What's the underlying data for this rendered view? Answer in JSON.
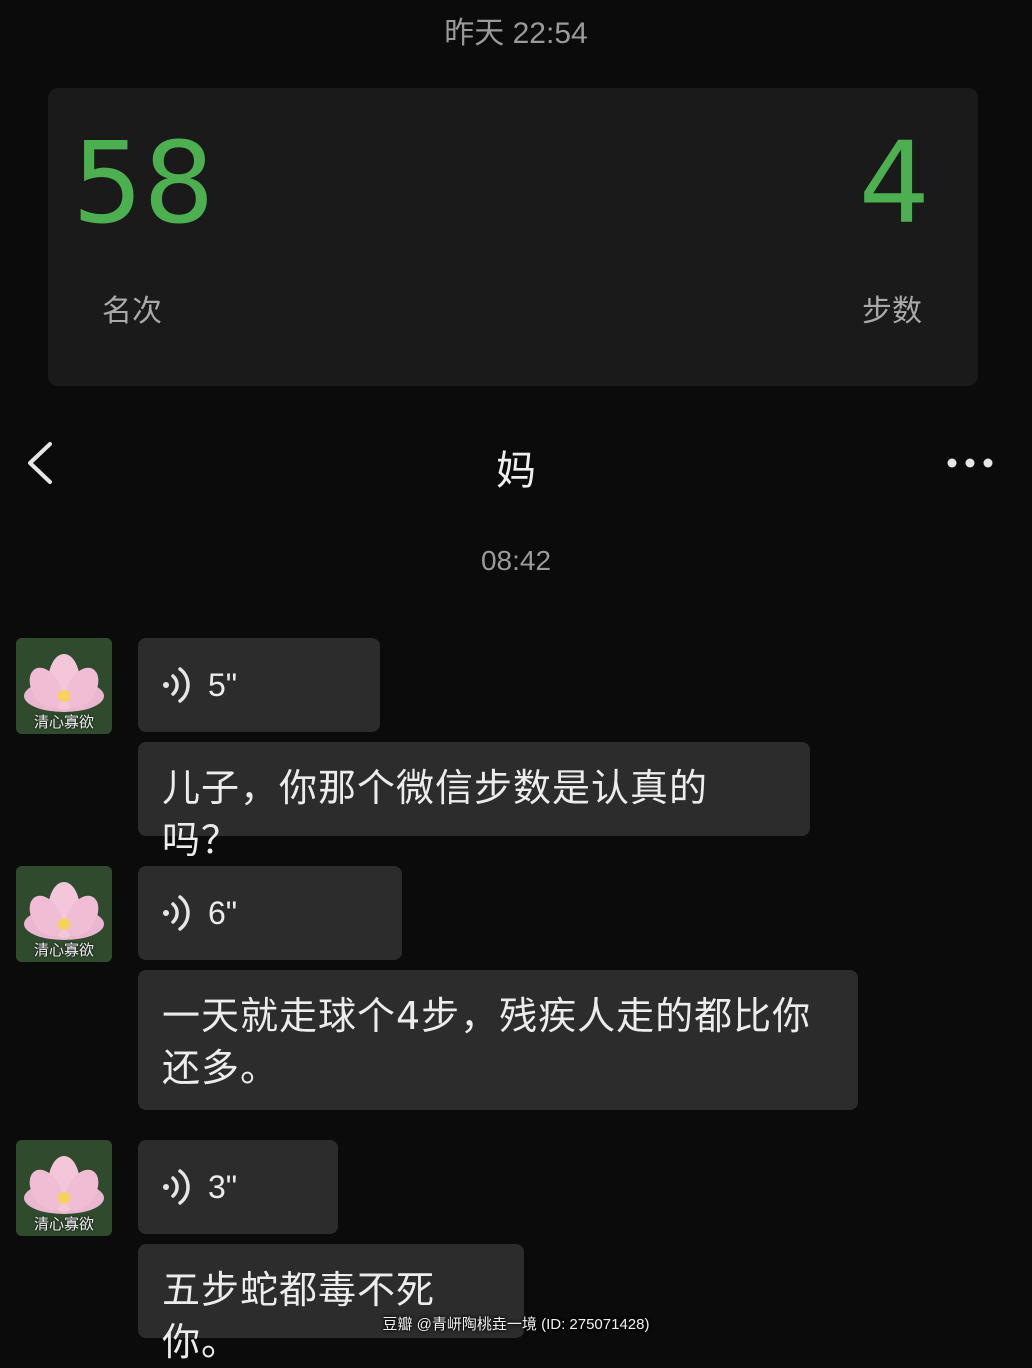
{
  "header": {
    "time": "昨天 22:54"
  },
  "steps_card": {
    "rank_value": "58",
    "rank_label": "名次",
    "steps_value": "4",
    "steps_label": "步数",
    "accent": "#4caf50"
  },
  "chat": {
    "title": "妈",
    "time": "08:42",
    "messages": [
      {
        "voice_duration": "5\"",
        "text": "儿子，你那个微信步数是认真的吗？"
      },
      {
        "voice_duration": "6\"",
        "text_line1": "一天就走球个4步，残疾人走的都比你",
        "text_line2": "还多。"
      },
      {
        "voice_duration": "3\"",
        "text": "五步蛇都毒不死你。"
      }
    ],
    "avatar_caption": "清心寡欲"
  },
  "watermark": "豆瓣   @青岍陶桃垚一境 (ID: 275071428)",
  "icons": {
    "back": "chevron-left-icon",
    "more": "more-dots-icon",
    "voice": "voice-wave-icon"
  }
}
